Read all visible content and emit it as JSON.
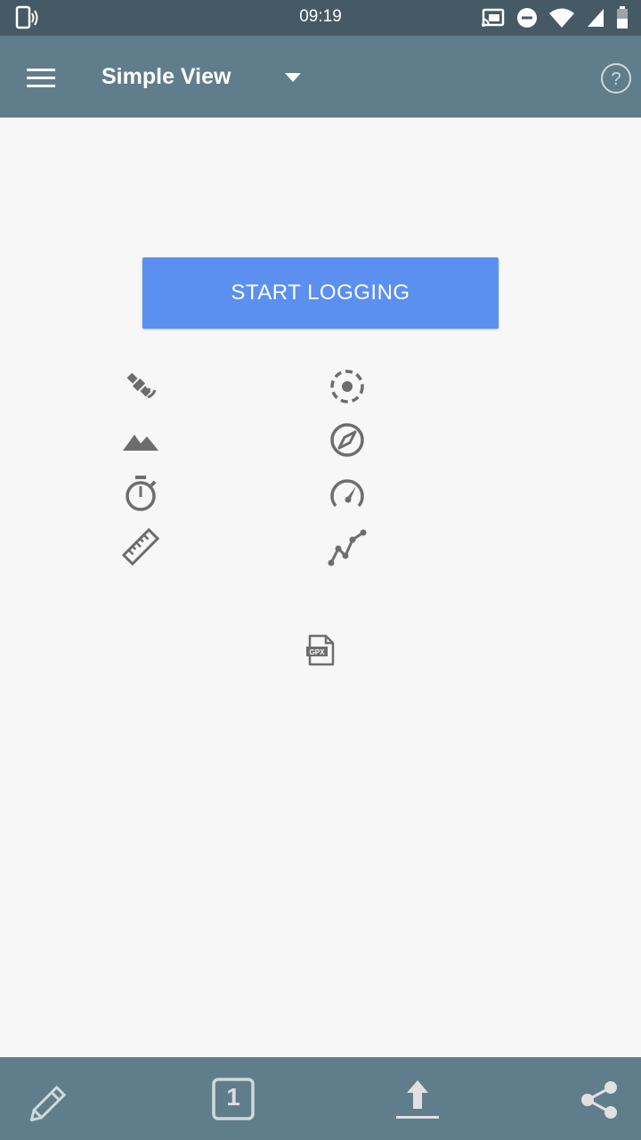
{
  "status_bar": {
    "time": "09:19",
    "icons": [
      "vibrate-icon",
      "cast-icon",
      "do-not-disturb-icon",
      "wifi-icon",
      "signal-icon",
      "battery-icon"
    ]
  },
  "app_bar": {
    "title": "Simple View",
    "icons": [
      "menu-icon",
      "dropdown-arrow-icon",
      "help-icon"
    ]
  },
  "main": {
    "start_button_label": "START LOGGING",
    "status_icons": [
      "satellite-icon",
      "accuracy-icon",
      "altitude-icon",
      "direction-icon",
      "duration-icon",
      "speed-icon",
      "distance-icon",
      "track-points-icon",
      "gpx-file-icon"
    ]
  },
  "bottom_bar": {
    "annotations_icon": "pencil-icon",
    "log_count": "1",
    "upload_icon": "upload-icon",
    "share_icon": "share-icon"
  },
  "colors": {
    "status_bar": "#455a64",
    "app_bar": "#607d8b",
    "accent_button": "#5b8ff0",
    "icon_gray": "#6d6d6d"
  }
}
